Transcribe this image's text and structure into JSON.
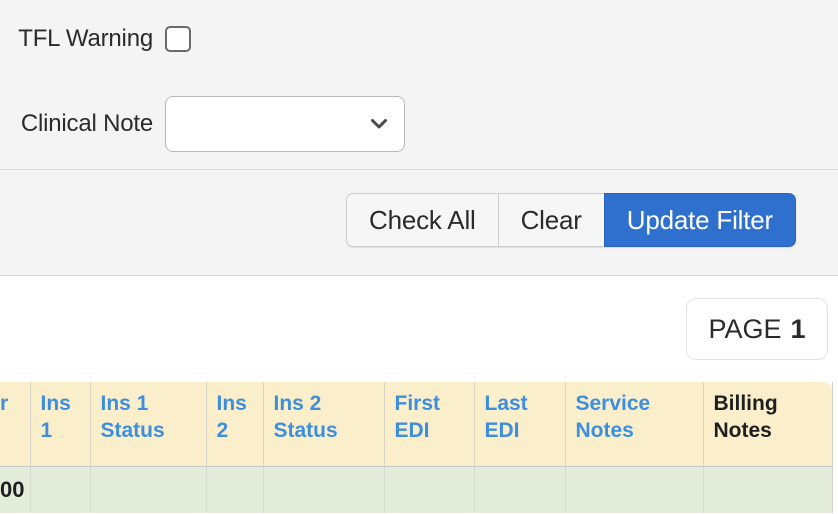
{
  "filter_panel": {
    "fields": [
      {
        "label": "TFL Warning",
        "type": "checkbox",
        "checked": false
      },
      {
        "label": "Clinical Note",
        "type": "select",
        "value": "",
        "icon": "chevron-down-icon"
      }
    ],
    "buttons": {
      "check_all": "Check All",
      "clear": "Clear",
      "update_filter": "Update Filter"
    }
  },
  "results": {
    "page_label": "PAGE",
    "page_number": "1"
  },
  "table": {
    "columns": [
      {
        "label": "r",
        "link": true,
        "clipped": true
      },
      {
        "label": "Ins 1",
        "link": true
      },
      {
        "label": "Ins 1 Status",
        "link": true
      },
      {
        "label": "Ins 2",
        "link": true
      },
      {
        "label": "Ins 2 Status",
        "link": true
      },
      {
        "label": "First EDI",
        "link": true
      },
      {
        "label": "Last EDI",
        "link": true
      },
      {
        "label": "Service Notes",
        "link": true
      },
      {
        "label": "Billing Notes",
        "link": false
      }
    ],
    "rows": [
      {
        "cells": [
          "00",
          "",
          "",
          "",
          "",
          "",
          "",
          "",
          ""
        ]
      }
    ]
  },
  "colors": {
    "panel_bg": "#f4f4f4",
    "primary_button": "#2f6fce",
    "header_bg": "#fbeecb",
    "header_link": "#3d8fdd",
    "row_bg": "#e3edda",
    "text": "#2b2b2b"
  }
}
